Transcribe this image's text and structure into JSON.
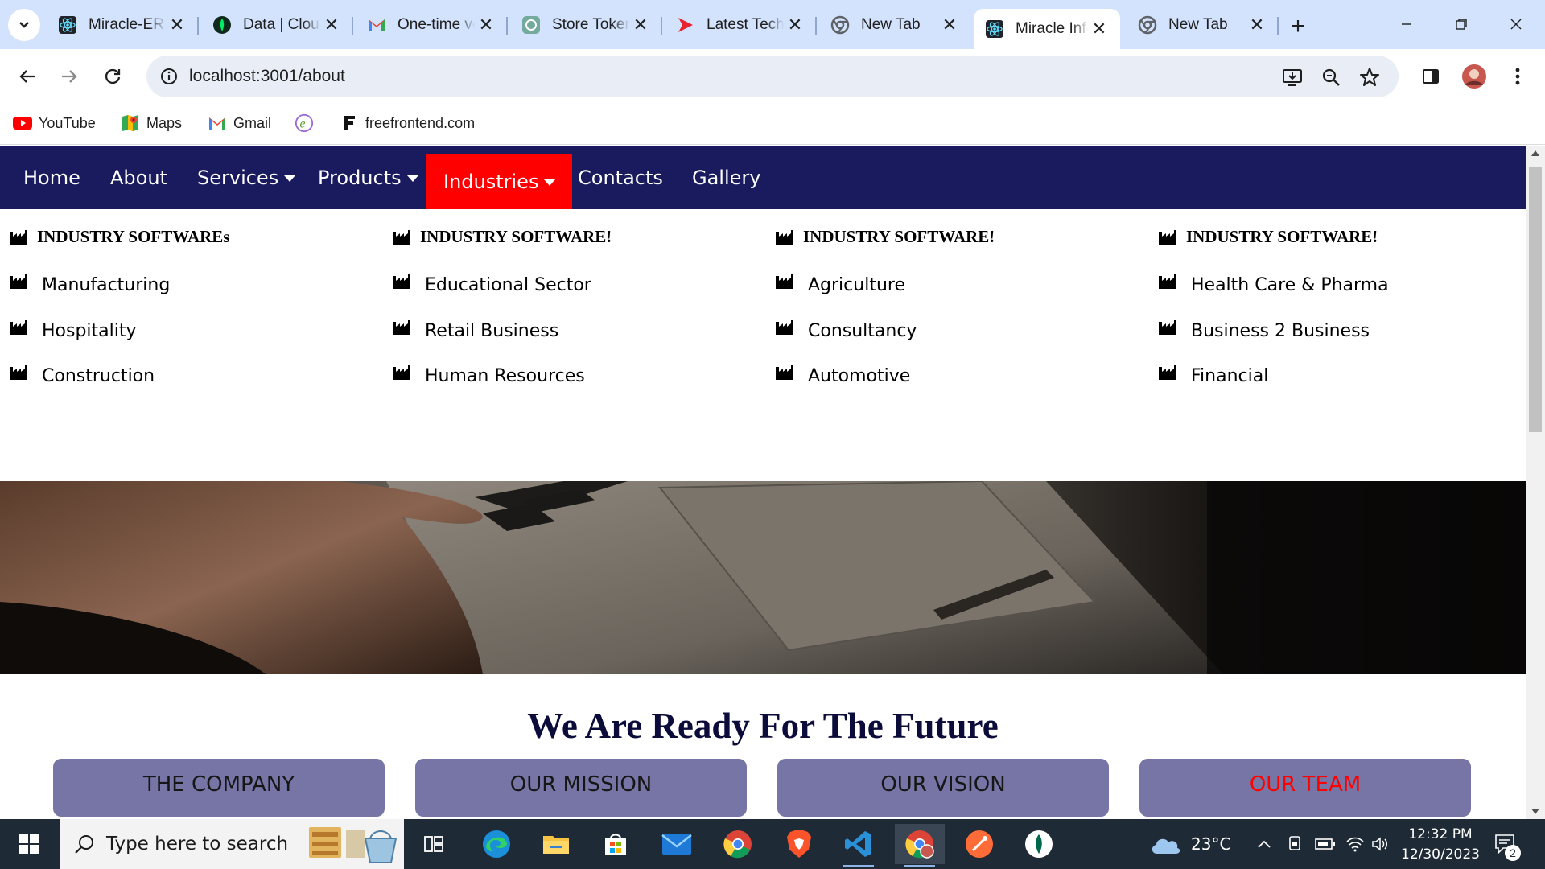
{
  "browser": {
    "tabs": [
      {
        "title": "Miracle-ERP",
        "icon": "react-icon"
      },
      {
        "title": "Data | Cloud",
        "icon": "mongodb-leaf-icon"
      },
      {
        "title": "One-time verification",
        "icon": "gmail-icon"
      },
      {
        "title": "Store Token",
        "icon": "chatgpt-icon"
      },
      {
        "title": "Latest Tech",
        "icon": "red-arrow-icon"
      },
      {
        "title": "New Tab",
        "icon": "chrome-icon"
      },
      {
        "title": "Miracle Info",
        "icon": "react-icon",
        "active": true
      },
      {
        "title": "New Tab",
        "icon": "chrome-icon"
      }
    ],
    "url": "localhost:3001/about",
    "bookmarks": [
      {
        "label": "YouTube",
        "icon": "youtube-icon"
      },
      {
        "label": "Maps",
        "icon": "maps-icon"
      },
      {
        "label": "Gmail",
        "icon": "gmail-icon"
      },
      {
        "label": "",
        "icon": "e-logo-icon"
      },
      {
        "label": "freefrontend.com",
        "icon": "freefrontend-icon"
      }
    ]
  },
  "site": {
    "nav": {
      "items": [
        {
          "label": "Home"
        },
        {
          "label": "About"
        },
        {
          "label": "Services"
        },
        {
          "label": "Products"
        },
        {
          "label": "Industries"
        },
        {
          "label": "Contacts"
        },
        {
          "label": "Gallery"
        }
      ],
      "active": "Industries",
      "colors": {
        "background": "#1a1a5e",
        "active": "#ff0000"
      }
    },
    "mega_menu": {
      "columns": [
        {
          "heading": "INDUSTRY SOFTWAREs",
          "items": [
            "Manufacturing",
            "Hospitality",
            "Construction"
          ]
        },
        {
          "heading": "INDUSTRY SOFTWARE!",
          "items": [
            "Educational Sector",
            "Retail Business",
            "Human Resources"
          ]
        },
        {
          "heading": "INDUSTRY SOFTWARE!",
          "items": [
            "Agriculture",
            "Consultancy",
            "Automotive"
          ]
        },
        {
          "heading": "INDUSTRY SOFTWARE!",
          "items": [
            "Health Care & Pharma",
            "Business 2 Business",
            "Financial"
          ]
        }
      ],
      "icon": "factory-icon"
    },
    "section_title": "We Are Ready For The Future",
    "cards": [
      {
        "label": "THE COMPANY"
      },
      {
        "label": "OUR MISSION"
      },
      {
        "label": "OUR VISION"
      },
      {
        "label": "OUR TEAM",
        "highlight": true
      }
    ],
    "card_color": "#7675a5"
  },
  "taskbar": {
    "search_placeholder": "Type here to search",
    "weather": "23°C",
    "time": "12:32 PM",
    "date": "12/30/2023",
    "notifications": "2"
  }
}
